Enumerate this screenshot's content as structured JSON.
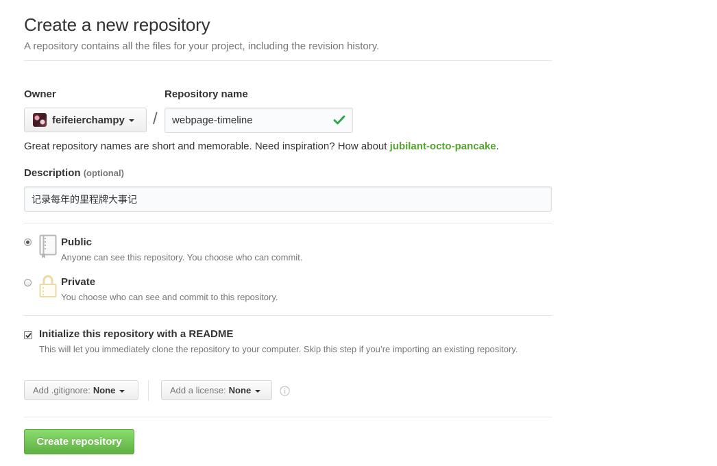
{
  "header": {
    "title": "Create a new repository",
    "subtitle": "A repository contains all the files for your project, including the revision history."
  },
  "owner": {
    "label": "Owner",
    "value": "feifeierchampy"
  },
  "repository": {
    "label": "Repository name",
    "value": "webpage-timeline",
    "valid": true
  },
  "hint": {
    "prefix": "Great repository names are short and memorable. Need inspiration? How about ",
    "suggestion": "jubilant-octo-pancake",
    "suffix": "."
  },
  "description": {
    "label": "Description",
    "optional_label": "(optional)",
    "value": "记录每年的里程牌大事记"
  },
  "visibility": {
    "selected": "public",
    "options": [
      {
        "title": "Public",
        "desc": "Anyone can see this repository. You choose who can commit."
      },
      {
        "title": "Private",
        "desc": "You choose who can see and commit to this repository."
      }
    ]
  },
  "readme": {
    "checked": true,
    "title": "Initialize this repository with a README",
    "desc": "This will let you immediately clone the repository to your computer. Skip this step if you’re importing an existing repository."
  },
  "gitignore": {
    "label": "Add .gitignore:",
    "value": "None"
  },
  "license": {
    "label": "Add a license:",
    "value": "None"
  },
  "submit": {
    "label": "Create repository"
  },
  "colors": {
    "accent_green": "#55a532",
    "button_green": "#60b044",
    "check_green": "#28a745",
    "private_lock": "#e9dba5"
  },
  "icons": [
    "repo-icon",
    "lock-icon",
    "check-icon",
    "info-icon",
    "caret-down-icon"
  ]
}
